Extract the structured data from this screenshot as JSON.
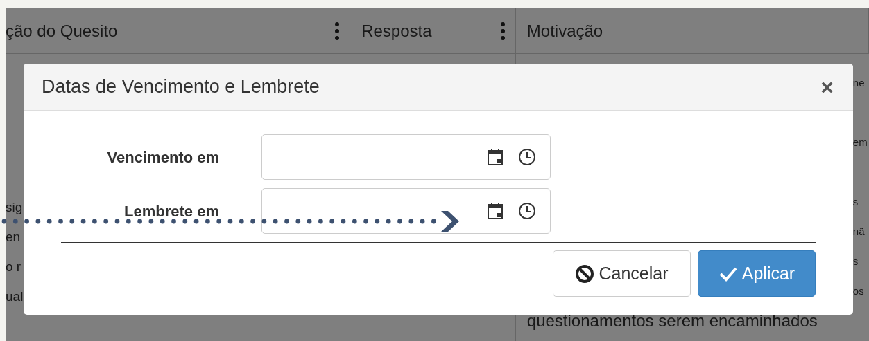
{
  "table": {
    "columns": [
      {
        "label": "ção do Quesito",
        "menu": true
      },
      {
        "label": "Resposta",
        "menu": true
      },
      {
        "label": "Motivação",
        "menu": false
      }
    ],
    "column_1_fragments": [
      "sig",
      "en",
      "o r",
      "ual"
    ],
    "column_3_fragments": [
      "ne",
      "em",
      "s",
      "nã",
      "s",
      "os"
    ],
    "column_3_last_line": "questionamentos serem encaminhados"
  },
  "dialog": {
    "title": "Datas de Vencimento e Lembrete",
    "close": "×",
    "fields": [
      {
        "label": "Vencimento em"
      },
      {
        "label": "Lembrete em"
      }
    ],
    "buttons": [
      {
        "label": "Cancelar",
        "kind": "cancel"
      },
      {
        "label": "Aplicar",
        "kind": "apply"
      }
    ]
  }
}
